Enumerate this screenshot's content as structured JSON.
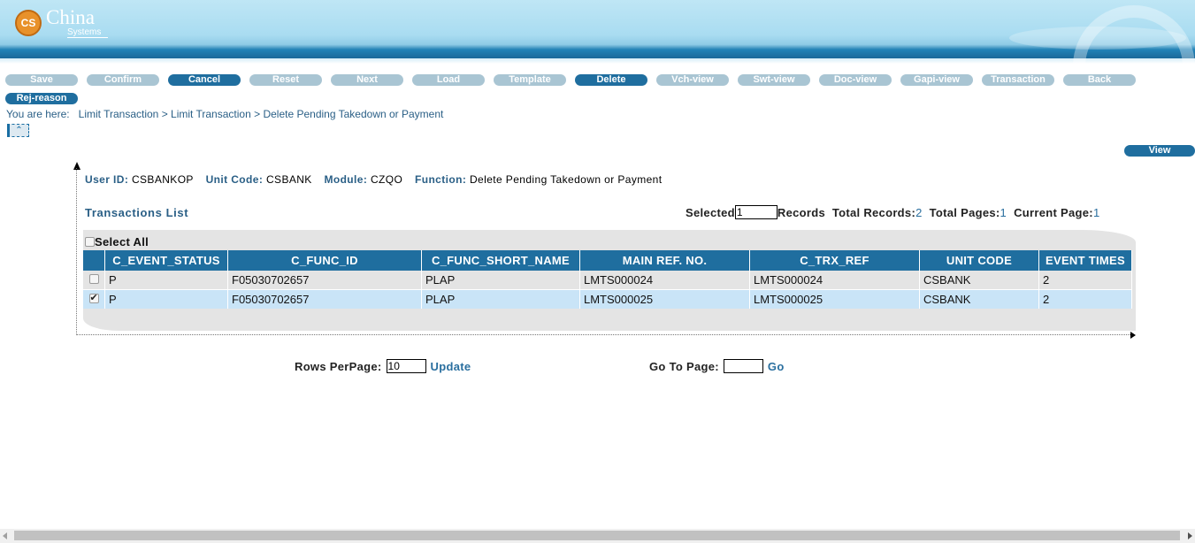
{
  "brand": {
    "logo_mark": "CS",
    "name": "China",
    "sub": "Systems"
  },
  "toolbar": {
    "buttons": [
      {
        "label": "Save",
        "active": false
      },
      {
        "label": "Confirm",
        "active": false
      },
      {
        "label": "Cancel",
        "active": true
      },
      {
        "label": "Reset",
        "active": false
      },
      {
        "label": "Next",
        "active": false
      },
      {
        "label": "Load",
        "active": false
      },
      {
        "label": "Template",
        "active": false
      },
      {
        "label": "Delete",
        "active": true
      },
      {
        "label": "Vch-view",
        "active": false
      },
      {
        "label": "Swt-view",
        "active": false
      },
      {
        "label": "Doc-view",
        "active": false
      },
      {
        "label": "Gapi-view",
        "active": false
      },
      {
        "label": "Transaction",
        "active": false
      },
      {
        "label": "Back",
        "active": false
      },
      {
        "label": "Rej-reason",
        "active": true
      }
    ]
  },
  "breadcrumb": {
    "prefix": "You are here:",
    "items": [
      "Limit Transaction",
      "Limit Transaction",
      "Delete Pending Takedown or Payment"
    ],
    "separator": ">"
  },
  "view_label": "View",
  "user_info": {
    "user_id_label": "User ID:",
    "user_id": "CSBANKOP",
    "unit_code_label": "Unit Code:",
    "unit_code": "CSBANK",
    "module_label": "Module:",
    "module": "CZQO",
    "function_label": "Function:",
    "function": "Delete Pending Takedown or Payment"
  },
  "list": {
    "title": "Transactions List",
    "selected_label": "Selected",
    "selected_value": "1",
    "records_label": "Records",
    "total_records_label": "Total Records:",
    "total_records": "2",
    "total_pages_label": "Total Pages:",
    "total_pages": "1",
    "current_page_label": "Current Page:",
    "current_page": "1",
    "select_all_label": "Select All",
    "columns": [
      "C_EVENT_STATUS",
      "C_FUNC_ID",
      "C_FUNC_SHORT_NAME",
      "MAIN REF. NO.",
      "C_TRX_REF",
      "UNIT CODE",
      "EVENT TIMES"
    ],
    "rows": [
      {
        "checked": false,
        "cells": [
          "P",
          "F05030702657",
          "PLAP",
          "LMTS000024",
          "LMTS000024",
          "CSBANK",
          "2"
        ]
      },
      {
        "checked": true,
        "cells": [
          "P",
          "F05030702657",
          "PLAP",
          "LMTS000025",
          "LMTS000025",
          "CSBANK",
          "2"
        ]
      }
    ]
  },
  "pager": {
    "rows_per_page_label": "Rows PerPage:",
    "rows_per_page_value": "10",
    "update_label": "Update",
    "goto_label": "Go To Page:",
    "goto_value": "",
    "go_label": "Go"
  },
  "colors": {
    "accent": "#1f6e9f",
    "button_inactive": "#a9c5d3",
    "label": "#2a5f86",
    "selected_row": "#c9e4f7"
  }
}
